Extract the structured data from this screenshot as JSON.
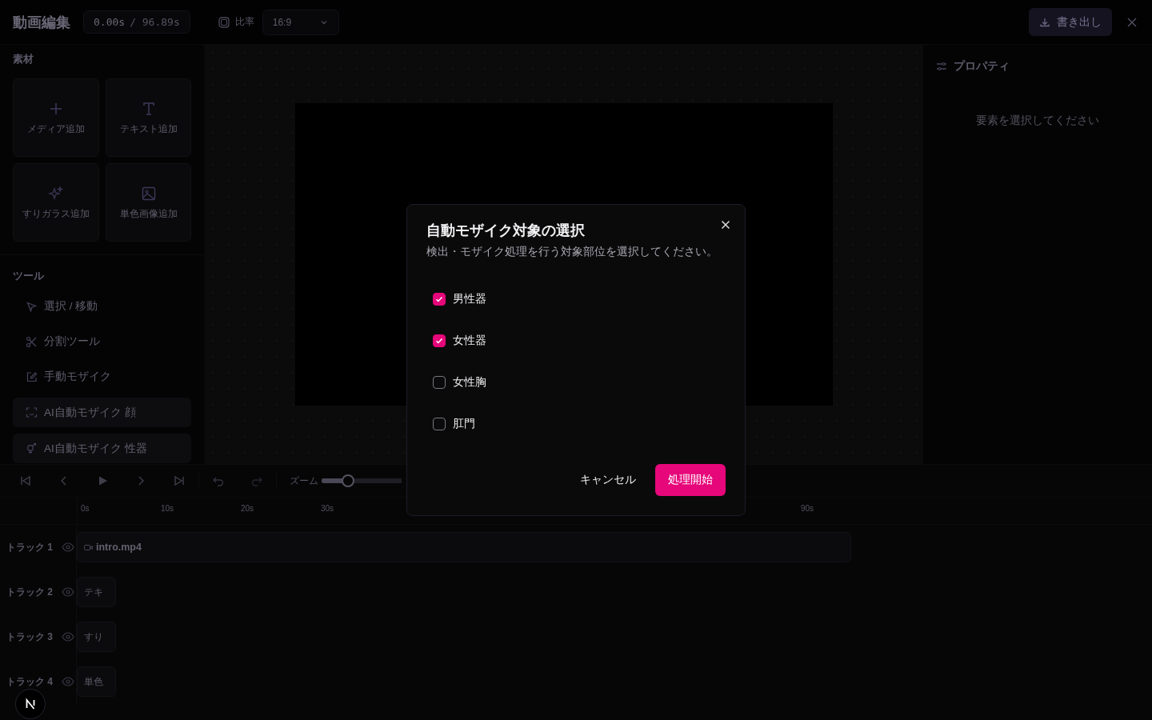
{
  "header": {
    "title": "動画編集",
    "time_current": "0.00s",
    "time_total": "/ 96.89s",
    "ratio_label": "比率",
    "ratio_value": "16:9",
    "export_button": "書き出し"
  },
  "sidebar": {
    "materials_heading": "素材",
    "materials": [
      {
        "label": "メディア追加",
        "kind": "plus"
      },
      {
        "label": "テキスト追加",
        "kind": "text"
      },
      {
        "label": "すりガラス追加",
        "kind": "sparkle"
      },
      {
        "label": "単色画像追加",
        "kind": "image"
      }
    ],
    "tools_heading": "ツール",
    "tools": [
      {
        "label": "選択 / 移動",
        "kind": "pointer",
        "boxed": false
      },
      {
        "label": "分割ツール",
        "kind": "scissors",
        "boxed": false
      },
      {
        "label": "手動モザイク",
        "kind": "edit",
        "boxed": false
      },
      {
        "label": "AI自動モザイク 顔",
        "kind": "face",
        "boxed": true
      },
      {
        "label": "AI自動モザイク 性器",
        "kind": "gender",
        "boxed": true
      }
    ]
  },
  "properties": {
    "title": "プロパティ",
    "empty_message": "要素を選択してください"
  },
  "timeline": {
    "zoom_label": "ズーム",
    "zoom": {
      "level": 0.33
    },
    "ruler": [
      "0s",
      "10s",
      "20s",
      "30s",
      "90s"
    ],
    "tracks": [
      {
        "label": "トラック 1",
        "clip": "intro.mp4",
        "kind": "video"
      },
      {
        "label": "トラック 2",
        "clip": "テキ",
        "kind": "short"
      },
      {
        "label": "トラック 3",
        "clip": "すり",
        "kind": "short"
      },
      {
        "label": "トラック 4",
        "clip": "単色",
        "kind": "short"
      }
    ]
  },
  "modal": {
    "title": "自動モザイク対象の選択",
    "subtitle": "検出・モザイク処理を行う対象部位を選択してください。",
    "options": [
      {
        "label": "男性器",
        "checked": true
      },
      {
        "label": "女性器",
        "checked": true
      },
      {
        "label": "女性胸",
        "checked": false
      },
      {
        "label": "肛門",
        "checked": false
      }
    ],
    "cancel_button": "キャンセル",
    "start_button": "処理開始"
  }
}
